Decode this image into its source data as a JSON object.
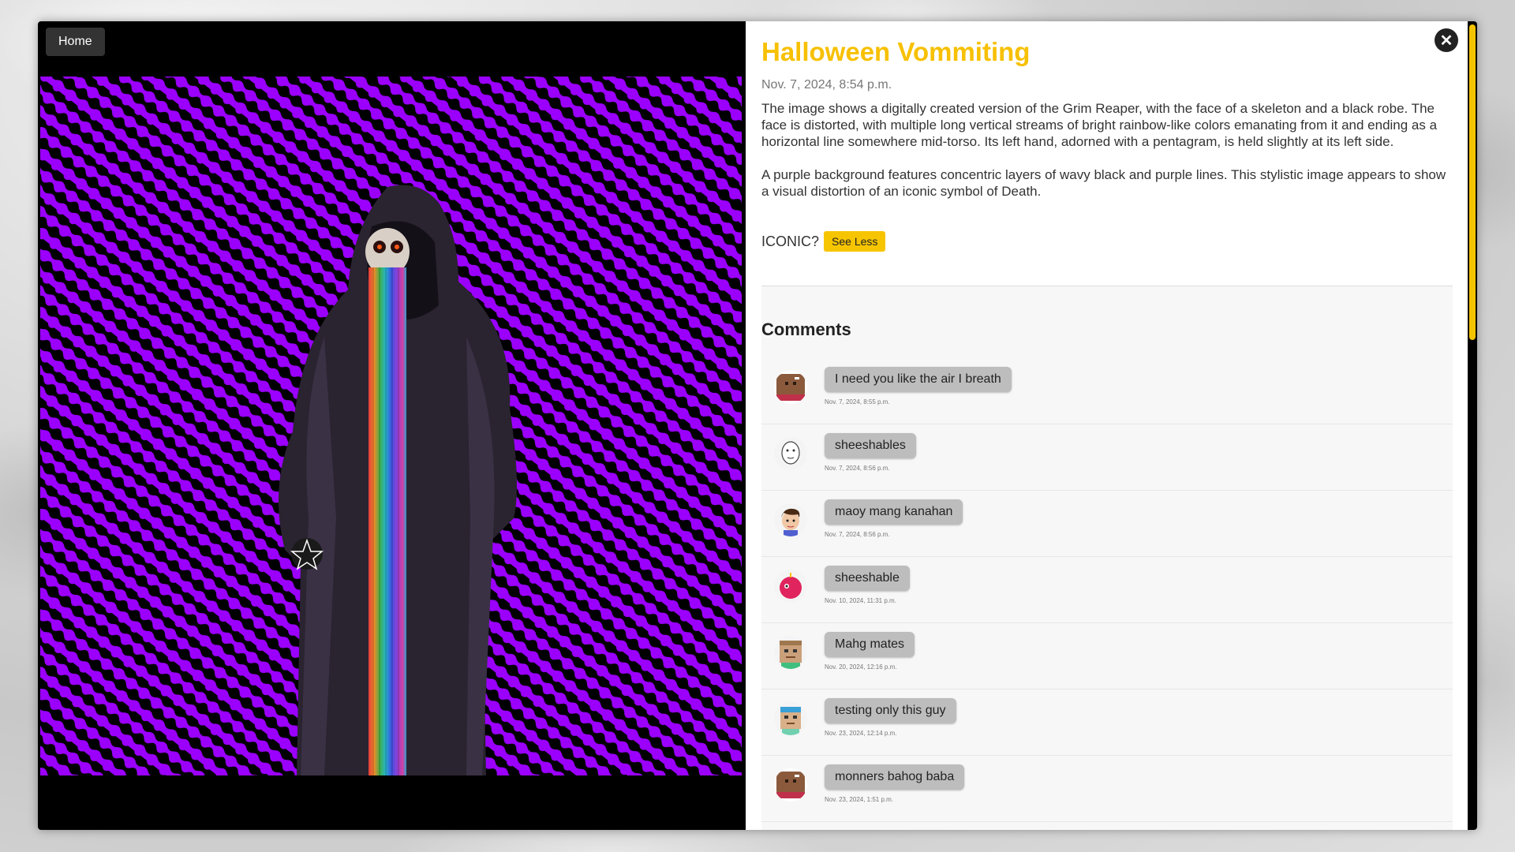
{
  "nav": {
    "home_label": "Home"
  },
  "close_symbol": "✕",
  "post": {
    "title": "Halloween Vommiting",
    "date": "Nov. 7, 2024, 8:54 p.m.",
    "description": [
      "The image shows a digitally created version of the Grim Reaper, with the face of a skeleton and a black robe. The face is distorted, with multiple long vertical streams of bright rainbow-like colors emanating from it and ending as a horizontal line somewhere mid-torso. Its left hand, adorned with a pentagram, is held slightly at its left side.",
      "A purple background features concentric layers of wavy black and purple lines. This stylistic image appears to show a visual distortion of an iconic symbol of Death."
    ],
    "tag_label": "ICONIC?",
    "see_less_label": "See Less"
  },
  "comments": {
    "heading": "Comments",
    "items": [
      {
        "text": "I need you like the air I breath",
        "time": "Nov. 7, 2024, 8:55 p.m.",
        "avatar": "brown-bear-avatar-icon"
      },
      {
        "text": "sheeshables",
        "time": "Nov. 7, 2024, 8:56 p.m.",
        "avatar": "sketch-face-avatar-icon"
      },
      {
        "text": "maoy mang kanahan",
        "time": "Nov. 7, 2024, 8:56 p.m.",
        "avatar": "boy-avatar-icon"
      },
      {
        "text": "sheeshable",
        "time": "Nov. 10, 2024, 11:31 p.m.",
        "avatar": "pink-robot-avatar-icon"
      },
      {
        "text": "Mahg mates",
        "time": "Nov. 20, 2024, 12:16 p.m.",
        "avatar": "pixel-tan-avatar-icon"
      },
      {
        "text": "testing only this guy",
        "time": "Nov. 23, 2024, 12:14 p.m.",
        "avatar": "pixel-blue-hair-avatar-icon"
      },
      {
        "text": "monners bahog baba",
        "time": "Nov. 23, 2024, 1:51 p.m.",
        "avatar": "brown-bear-avatar-icon"
      }
    ]
  },
  "colors": {
    "accent": "#f7c000",
    "bubble": "#bdbdbd",
    "stripe_purple": "#9b00ff"
  }
}
